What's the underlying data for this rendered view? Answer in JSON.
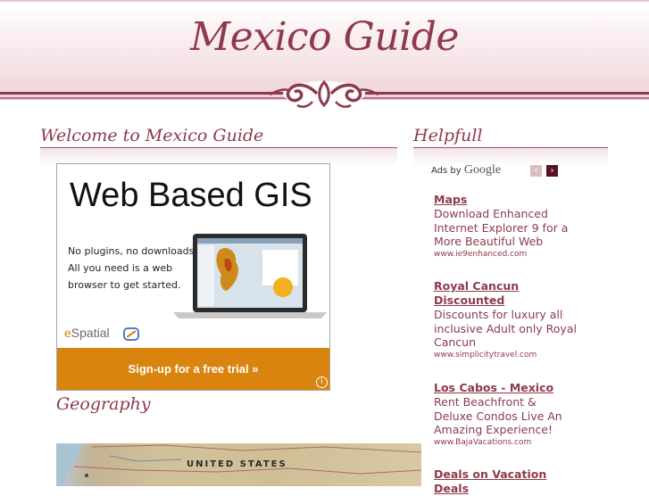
{
  "header": {
    "title": "Mexico Guide"
  },
  "main": {
    "title": "Welcome to Mexico Guide",
    "banner_ad": {
      "headline": "Web Based GIS",
      "body_lines": [
        "No plugins, no downloads.",
        "All you need is a web",
        "browser to get started."
      ],
      "brand_prefix": "e",
      "brand_rest": "Spatial",
      "cta": "Sign-up for a free trial »",
      "info_icon": "i"
    },
    "geography_title": "Geography",
    "map_label": "UNITED STATES"
  },
  "sidebar": {
    "title": "Helpfull",
    "ads_by": "Ads by",
    "google": "Google",
    "prev_label": "‹",
    "next_label": "›",
    "ads": [
      {
        "title": "Maps",
        "desc": "Download Enhanced Internet Explorer 9 for a More Beautiful Web",
        "url": "www.ie9enhanced.com"
      },
      {
        "title": "Royal Cancun Discounted",
        "desc": "Discounts for luxury all inclusive Adult only Royal Cancun",
        "url": "www.simplicitytravel.com"
      },
      {
        "title": "Los Cabos - Mexico",
        "desc": "Rent Beachfront & Deluxe Condos Live An Amazing Experience!",
        "url": "www.BajaVacations.com"
      },
      {
        "title": "Deals on Vacation Deals",
        "desc": "",
        "url": ""
      }
    ]
  },
  "colors": {
    "accent": "#8e3a4b",
    "cta": "#d9840f"
  }
}
